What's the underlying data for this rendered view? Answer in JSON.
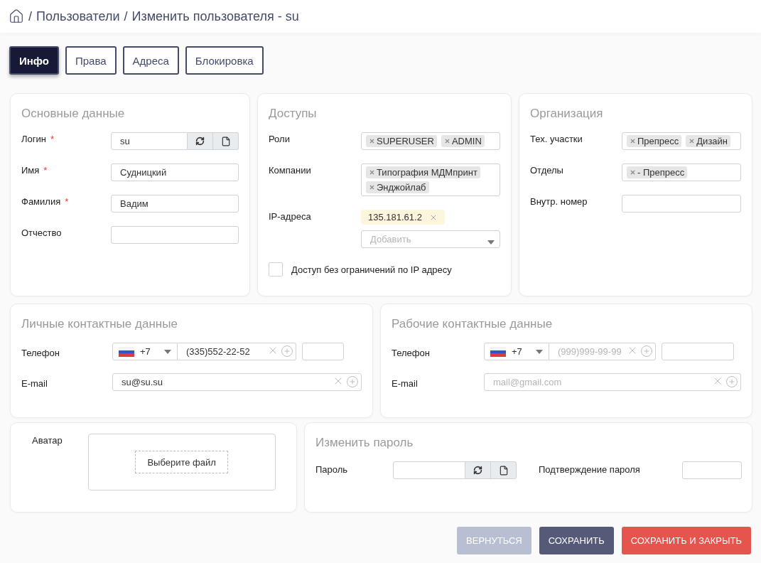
{
  "breadcrumb": {
    "separator": "/",
    "items": [
      "Пользователи",
      "Изменить пользователя - su"
    ]
  },
  "tabs": [
    {
      "label": "Инфо",
      "selected": true
    },
    {
      "label": "Права",
      "selected": false
    },
    {
      "label": "Адреса",
      "selected": false
    },
    {
      "label": "Блокировка",
      "selected": false
    }
  ],
  "basic": {
    "title": "Основные данные",
    "fields": [
      {
        "kind": "login",
        "label": "Логин",
        "mark": "*",
        "value": "su"
      },
      {
        "kind": "text",
        "label": "Имя",
        "mark": "*",
        "value": "Судницкий"
      },
      {
        "kind": "text",
        "label": "Фамилия",
        "mark": "*",
        "value": "Вадим"
      },
      {
        "kind": "text",
        "label": "Отчество"
      }
    ]
  },
  "access": {
    "title": "Доступы",
    "fields": [
      {
        "kind": "tags",
        "label": "Роли",
        "tags": [
          "SUPERUSER",
          "ADMIN"
        ]
      },
      {
        "kind": "tags",
        "label": "Компании",
        "tags": [
          "Типография МДМпринт",
          "Энджойлаб"
        ]
      },
      {
        "kind": "ip",
        "label": "IP-адреса",
        "tags": [
          "135.181.61.2"
        ],
        "placeholder": "Добавить"
      }
    ],
    "checkbox": {
      "label": "Доступ без ограничений по IP адресу",
      "checked": false
    }
  },
  "org": {
    "title": "Организация",
    "fields": [
      {
        "kind": "tags",
        "label": "Тех. участки",
        "tags": [
          "Препресс",
          "Дизайн"
        ]
      },
      {
        "kind": "tags",
        "label": "Отделы",
        "tags": [
          "- Препресс"
        ]
      },
      {
        "kind": "text",
        "label": "Внутр. номер"
      }
    ]
  },
  "contacts": [
    {
      "title": "Личные контактные данные",
      "phone": {
        "label": "Телефон",
        "code": "+7",
        "value": "(335)552-22-52"
      },
      "email": {
        "label": "E-mail",
        "value": "su@su.su"
      }
    },
    {
      "title": "Рабочие контактные данные",
      "phone": {
        "label": "Телефон",
        "code": "+7",
        "placeholder": "(999)999-99-99"
      },
      "email": {
        "label": "E-mail",
        "placeholder": "mail@gmail.com"
      }
    }
  ],
  "avatar": {
    "label": "Аватар",
    "button": "Выберите файл"
  },
  "password": {
    "title": "Изменить пароль",
    "label": "Пароль",
    "confirm_label": "Подтверждение пароля"
  },
  "buttons": [
    {
      "kind": "back",
      "label": "ВЕРНУТЬСЯ"
    },
    {
      "kind": "save",
      "label": "СОХРАНИТЬ"
    },
    {
      "kind": "save_close",
      "label": "СОХРАНИТЬ И ЗАКРЫТЬ"
    }
  ]
}
